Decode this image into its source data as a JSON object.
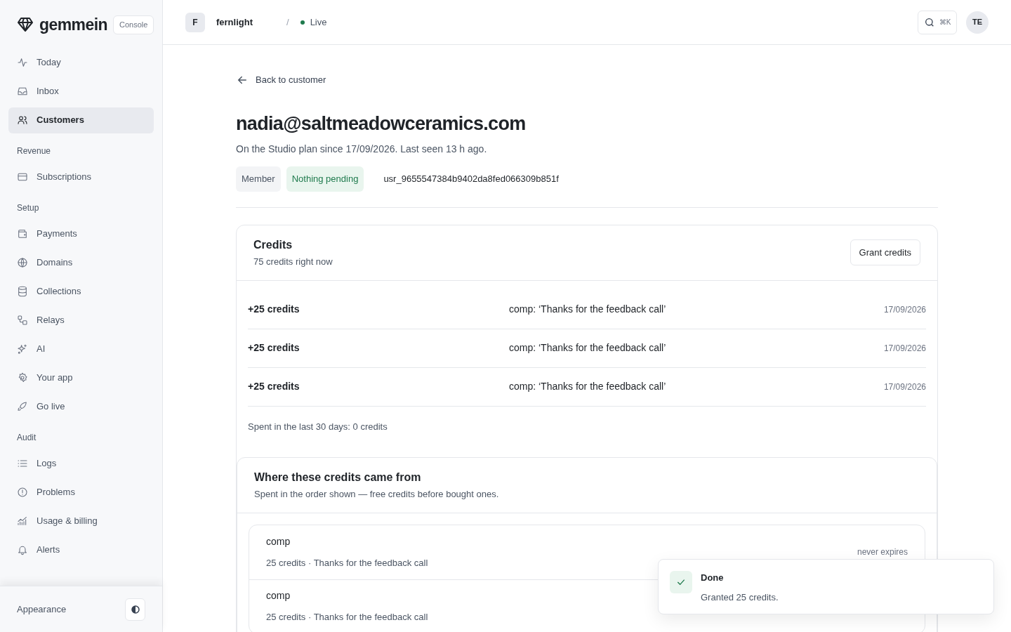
{
  "brand": {
    "name": "gemmein",
    "badge": "Console"
  },
  "sidebar": {
    "groups": [
      {
        "items": [
          {
            "label": "Today",
            "selected": false
          },
          {
            "label": "Inbox",
            "selected": false
          },
          {
            "label": "Customers",
            "selected": true
          }
        ]
      },
      {
        "heading": "Revenue",
        "items": [
          {
            "label": "Subscriptions",
            "selected": false
          }
        ]
      },
      {
        "heading": "Setup",
        "items": [
          {
            "label": "Payments",
            "selected": false
          },
          {
            "label": "Domains",
            "selected": false
          },
          {
            "label": "Collections",
            "selected": false
          },
          {
            "label": "Relays",
            "selected": false
          },
          {
            "label": "AI",
            "selected": false
          },
          {
            "label": "Your app",
            "selected": false
          },
          {
            "label": "Go live",
            "selected": false
          }
        ]
      },
      {
        "heading": "Audit",
        "items": [
          {
            "label": "Logs",
            "selected": false
          },
          {
            "label": "Problems",
            "selected": false
          },
          {
            "label": "Usage & billing",
            "selected": false
          },
          {
            "label": "Alerts",
            "selected": false
          }
        ]
      }
    ],
    "footer": {
      "label": "Appearance"
    }
  },
  "topbar": {
    "project_initial": "F",
    "project": "fernlight",
    "separator": "/",
    "environment": "Live",
    "shortcut": "⌘K",
    "avatar": "TE"
  },
  "back_link": "Back to customer",
  "customer": {
    "email": "nadia@saltmeadowceramics.com",
    "summary": "On the Studio plan since 17/09/2026. Last seen 13 h ago.",
    "badges": [
      {
        "label": "Member",
        "kind": "neutral"
      },
      {
        "label": "Nothing pending",
        "kind": "success"
      }
    ],
    "user_id": "usr_9655547384b9402da8fed066309b851f"
  },
  "credits": {
    "title": "Credits",
    "subtitle": "75 credits right now",
    "button": "Grant credits",
    "rows": [
      {
        "amount": "+25 credits",
        "note": "comp: ‘Thanks for the feedback call’",
        "date": "17/09/2026"
      },
      {
        "amount": "+25 credits",
        "note": "comp: ‘Thanks for the feedback call’",
        "date": "17/09/2026"
      },
      {
        "amount": "+25 credits",
        "note": "comp: ‘Thanks for the feedback call’",
        "date": "17/09/2026"
      }
    ],
    "spent": "Spent in the last 30 days: 0 credits"
  },
  "sources": {
    "title": "Where these credits came from",
    "subtitle": "Spent in the order shown — free credits before bought ones.",
    "items": [
      {
        "name": "comp",
        "detail": "25 credits · Thanks for the feedback call",
        "expiry": "never expires"
      },
      {
        "name": "comp",
        "detail": "25 credits · Thanks for the feedback call"
      }
    ]
  },
  "toast": {
    "title": "Done",
    "message": "Granted 25 credits."
  }
}
